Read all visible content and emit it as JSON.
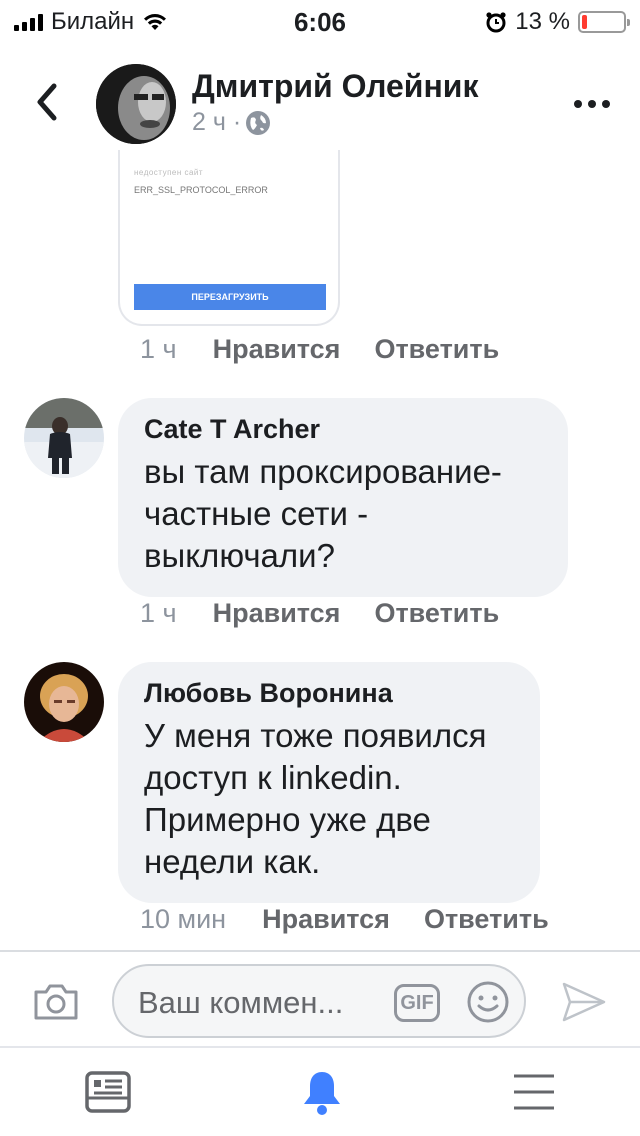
{
  "status_bar": {
    "carrier": "Билайн",
    "time": "6:06",
    "battery_percent": "13 %",
    "battery_level": 0.13,
    "battery_color": "#ff3b30"
  },
  "header": {
    "author_name": "Дмитрий Олейник",
    "time_ago": "2 ч ·",
    "audience_icon": "globe-icon",
    "back_icon": "chevron-left-icon",
    "more_icon": "more-horizontal-icon"
  },
  "attachment": {
    "error_top": "недоступен сайт",
    "error_code": "ERR_SSL_PROTOCOL_ERROR",
    "reload_label": "ПЕРЕЗАГРУЗИТЬ",
    "time": "1 ч",
    "like_label": "Нравится",
    "reply_label": "Ответить"
  },
  "comments": [
    {
      "name": "Cate T Archer",
      "text": [
        "вы там проксирование-",
        "частные сети -",
        "выключали?"
      ],
      "time": "1 ч",
      "like_label": "Нравится",
      "reply_label": "Ответить"
    },
    {
      "name": "Любовь Воронина",
      "text": [
        "У меня тоже появился",
        "доступ к linkedin.",
        "Примерно уже две",
        "недели как."
      ],
      "time": "10 мин",
      "like_label": "Нравится",
      "reply_label": "Ответить"
    }
  ],
  "composer": {
    "placeholder": "Ваш коммен...",
    "gif_label": "GIF",
    "camera_icon": "camera-icon",
    "emoji_icon": "emoji-icon",
    "send_icon": "send-icon"
  },
  "tab_bar": {
    "items": [
      "news-feed-icon",
      "notifications-icon",
      "menu-icon"
    ],
    "active_color": "#4080ff"
  }
}
